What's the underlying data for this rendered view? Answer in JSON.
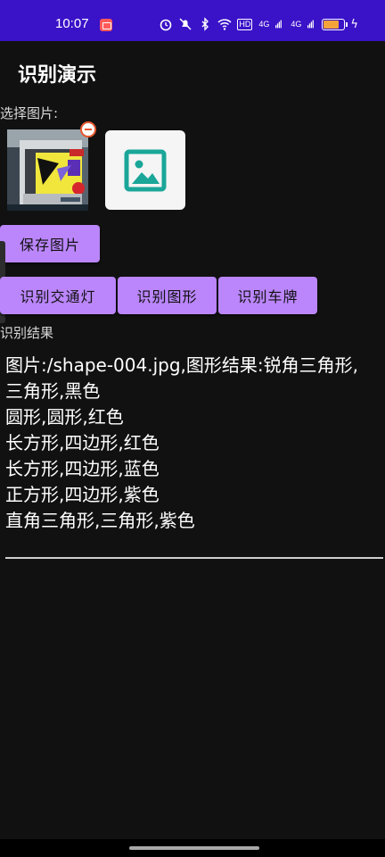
{
  "status_bar": {
    "time": "10:07",
    "icons": [
      "screen-record-icon",
      "alarm-icon",
      "mute-icon",
      "bluetooth-icon",
      "wifi-icon",
      "hd-icon",
      "signal-4g-icon",
      "signal-4g-icon",
      "battery-icon",
      "charging-icon"
    ],
    "hd_label": "HD",
    "net1": "4G",
    "net2": "4G",
    "battery_level": 0.7,
    "battery_color": "#f3a33a"
  },
  "app": {
    "title": "识别演示"
  },
  "select_label": "选择图片:",
  "buttons": {
    "save": "保存图片",
    "traffic_light": "识别交通灯",
    "shape": "识别图形",
    "plate": "识别车牌"
  },
  "result_label": "识别结果",
  "result_text": "图片:/shape-004.jpg,图形结果:锐角三角形,\n三角形,黑色\n圆形,圆形,红色\n长方形,四边形,红色\n长方形,四边形,蓝色\n正方形,四边形,紫色\n直角三角形,三角形,紫色",
  "colors": {
    "accent": "#bb86fc",
    "status_bar": "#3a12c8",
    "background": "#111111",
    "placeholder_icon": "#1aa699"
  }
}
